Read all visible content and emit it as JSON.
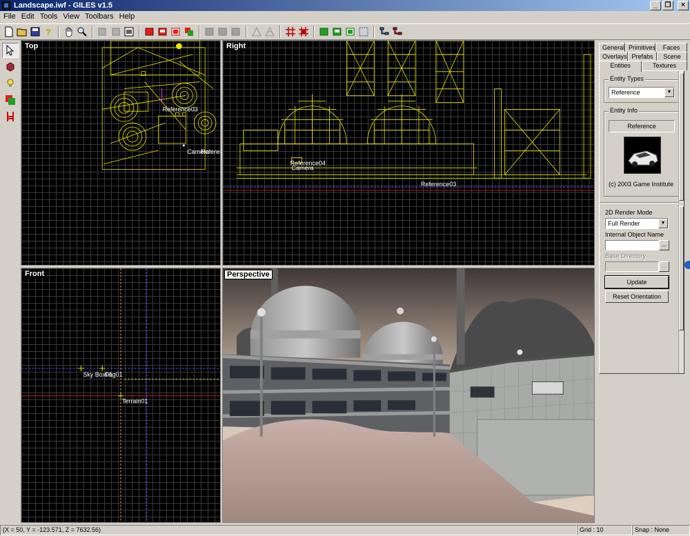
{
  "window": {
    "title": "Landscape.iwf - GILES v1.5"
  },
  "menu": [
    "File",
    "Edit",
    "Tools",
    "View",
    "Toolbars",
    "Help"
  ],
  "toolbar_icons": [
    "new-file-icon",
    "open-folder-icon",
    "save-icon",
    "help-icon",
    "pan-hand-icon",
    "zoom-icon",
    "cut-icon",
    "copy-icon",
    "properties-icon",
    "red-box-icon",
    "red-box-2-icon",
    "red-box-3-icon",
    "red-green-box-icon",
    "gray-box-icon",
    "gray-box-2-icon",
    "gray-box-3-icon",
    "wire-a-icon",
    "wire-b-icon",
    "grid-icon",
    "snap-icon",
    "green-box-icon",
    "green-box-2-icon",
    "green-box-3-icon",
    "vertex-icon",
    "tree-icon",
    "tree-2-icon"
  ],
  "left_tools": [
    "select-arrow-icon",
    "cube-icon",
    "light-bulb-icon",
    "brush-icon",
    "entity-chair-icon"
  ],
  "viewports": {
    "top": {
      "label": "Top",
      "entity_labels": [
        "Reference03",
        "Camera",
        "Referen"
      ]
    },
    "right": {
      "label": "Right",
      "entity_labels": [
        "Reference04",
        "Camera",
        "Reference03"
      ]
    },
    "front": {
      "label": "Front",
      "entity_labels": [
        "Sky Box01",
        "Fog01",
        "Terrain01"
      ]
    },
    "perspective": {
      "label": "Perspective"
    }
  },
  "panel": {
    "tabs_row1": [
      "General",
      "Primitives",
      "Faces"
    ],
    "tabs_row2": [
      "Overlays",
      "Prefabs",
      "Scene"
    ],
    "tabs_row3": [
      "Entities",
      "Textures"
    ],
    "active_tab": "Entities",
    "entity_types_title": "Entity Types",
    "entity_type_value": "Reference",
    "entity_info_title": "Entity Info",
    "entity_info_name": "Reference",
    "copyright": "(c) 2003 Game Institute",
    "render_mode_label": "2D Render Mode",
    "render_mode_value": "Full Render",
    "internal_name_label": "Internal Object Name",
    "internal_name_value": "",
    "base_dir_label": "Base Directory",
    "base_dir_value": "",
    "update_label": "Update",
    "reset_label": "Reset Orientation",
    "dots": "..."
  },
  "status": {
    "coords": "(X = 50, Y = -123.571, Z = 7632.56)",
    "grid": "Grid : 10",
    "snap": "Snap : None"
  }
}
